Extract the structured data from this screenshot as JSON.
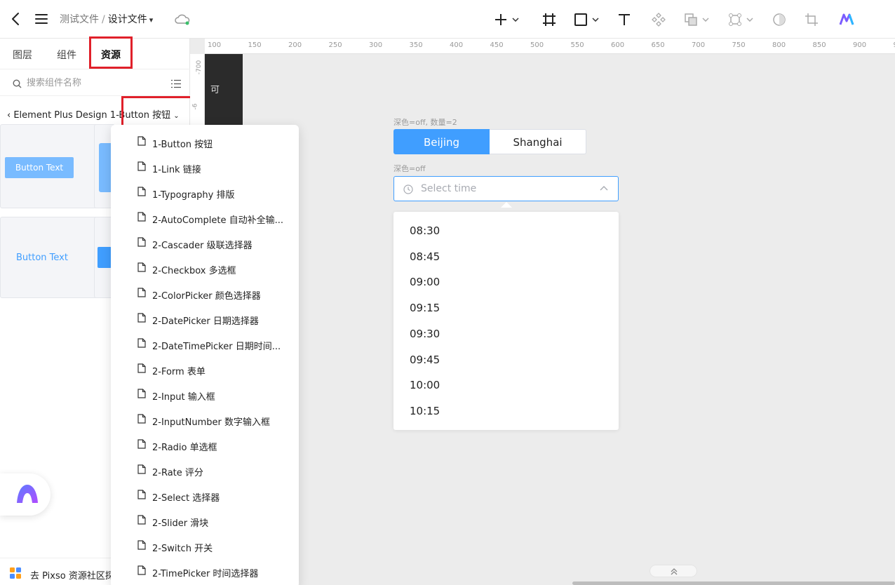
{
  "topbar": {
    "breadcrumb_parent": "测试文件",
    "separator": "/",
    "breadcrumb_current": "设计文件",
    "tools": [
      "plus-icon",
      "frame-icon",
      "rectangle-icon",
      "text-tool-icon",
      "component-icon",
      "boolean-icon",
      "vector-icon",
      "mask-icon",
      "crop-icon",
      "ai-logo-icon"
    ]
  },
  "left_panel": {
    "tabs": [
      "图层",
      "组件",
      "资源"
    ],
    "active_tab": "资源",
    "search_placeholder": "搜索组件名称",
    "library_name": "Element Plus Design",
    "library_page": "1-Button 按钮",
    "card_labels": [
      "Button Text",
      "Button Text"
    ],
    "community_link": "去 Pixso 资源社区探"
  },
  "dropdown": {
    "items": [
      "1-Button 按钮",
      "1-Link 链接",
      "1-Typography 排版",
      "2-AutoComplete 自动补全输...",
      "2-Cascader 级联选择器",
      "2-Checkbox 多选框",
      "2-ColorPicker 颜色选择器",
      "2-DatePicker 日期选择器",
      "2-DateTimePicker 日期时间...",
      "2-Form 表单",
      "2-Input 输入框",
      "2-InputNumber 数字输入框",
      "2-Radio 单选框",
      "2-Rate 评分",
      "2-Select 选择器",
      "2-Slider 滑块",
      "2-Switch 开关",
      "2-TimePicker 时间选择器"
    ]
  },
  "canvas": {
    "ruler_ticks": [
      "100",
      "150",
      "200",
      "250",
      "300",
      "350",
      "400",
      "450",
      "500",
      "550",
      "600",
      "650",
      "700",
      "750",
      "800",
      "850",
      "900",
      "9"
    ],
    "vertical_ruler_ticks": [
      "-700",
      "-6"
    ],
    "dark_frame_text": "可",
    "segmented": {
      "caption": "深色=off, 数量=2",
      "options": [
        "Beijing",
        "Shanghai"
      ],
      "selected": "Beijing"
    },
    "time_picker": {
      "caption": "深色=off",
      "placeholder": "Select time",
      "options": [
        "08:30",
        "08:45",
        "09:00",
        "09:15",
        "09:30",
        "09:45",
        "10:00",
        "10:15"
      ]
    }
  },
  "colors": {
    "accent": "#409eff",
    "highlight_box": "#e0202a"
  }
}
